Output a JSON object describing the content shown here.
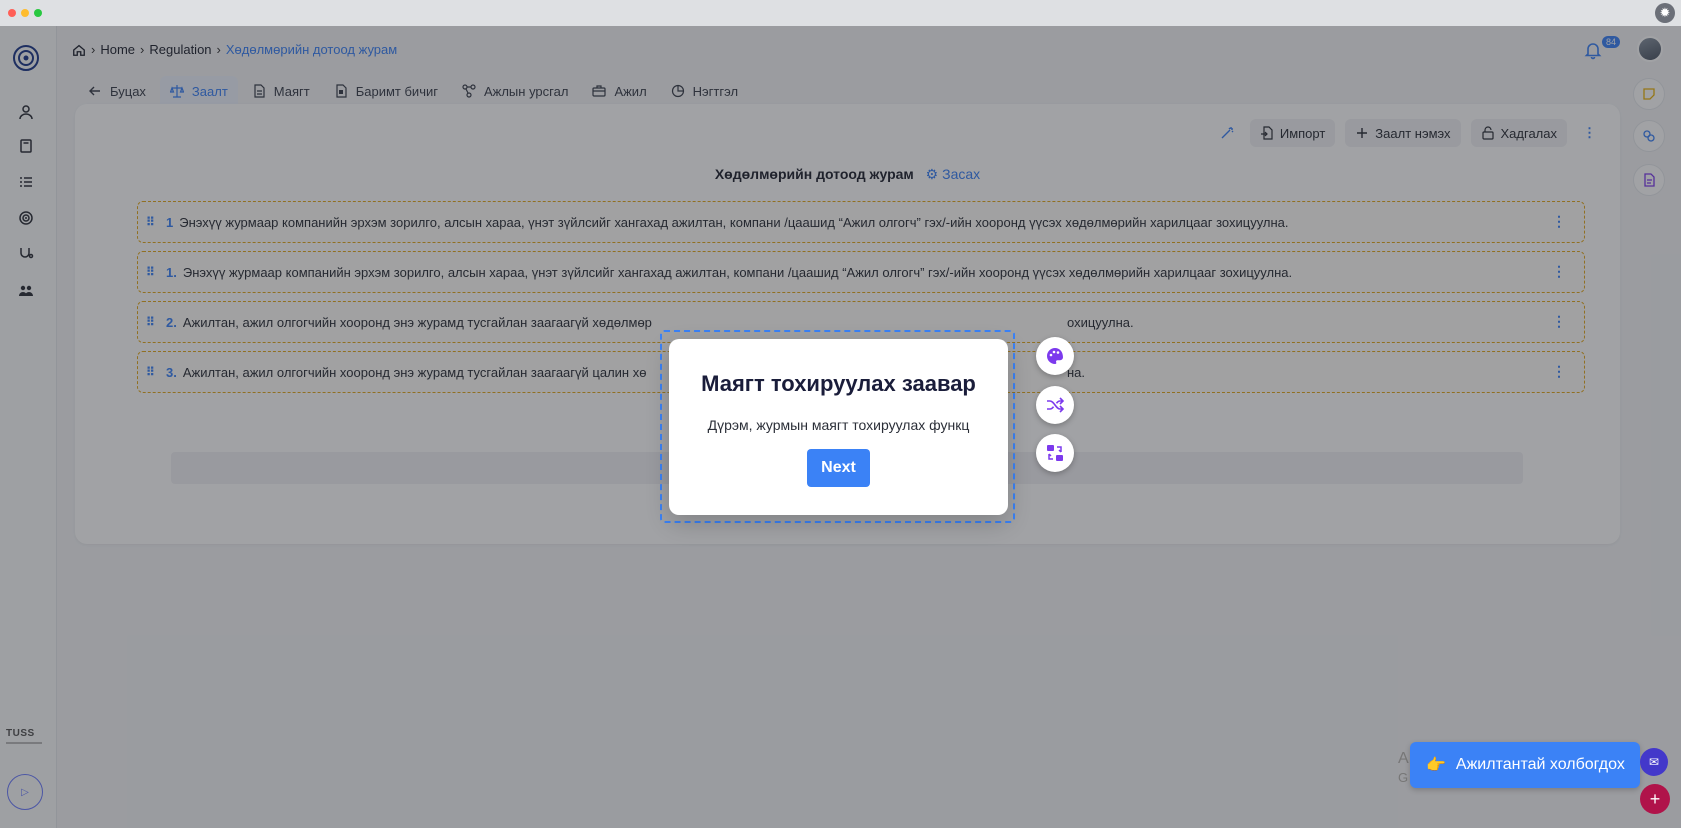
{
  "window": {
    "dots": [
      "#ff5f57",
      "#febc2e",
      "#28c840"
    ]
  },
  "breadcrumb": {
    "home": "Home",
    "regulation": "Regulation",
    "current": "Хөдөлмөрийн дотоод журам"
  },
  "notifications": {
    "count": "84"
  },
  "tabs": [
    {
      "label": "Буцах",
      "icon": "arrow-left-icon"
    },
    {
      "label": "Заалт",
      "icon": "scale-icon",
      "active": true
    },
    {
      "label": "Маягт",
      "icon": "document-icon"
    },
    {
      "label": "Баримт бичиг",
      "icon": "file-icon"
    },
    {
      "label": "Ажлын урсгал",
      "icon": "workflow-icon"
    },
    {
      "label": "Ажил",
      "icon": "briefcase-icon"
    },
    {
      "label": "Нэгтгэл",
      "icon": "chart-pie-icon"
    }
  ],
  "toolbar": {
    "import": "Импорт",
    "add_clause": "Заалт нэмэх",
    "lock": "Хадгалах"
  },
  "document": {
    "title": "Хөдөлмөрийн дотоод журам",
    "edit": "Засах"
  },
  "rules": [
    {
      "num": "1",
      "text": "Энэхүү журмаар компанийн эрхэм зорилго, алсын хараа, үнэт зүйлсийг хангахад ажилтан, компани /цаашид “Ажил олгогч” гэх/-ийн хооронд үүсэх хөдөлмөрийн харилцааг зохицуулна."
    },
    {
      "num": "1.",
      "text": "Энэхүү журмаар компанийн эрхэм зорилго, алсын хараа, үнэт зүйлсийг хангахад ажилтан, компани /цаашид “Ажил олгогч” гэх/-ийн хооронд үүсэх хөдөлмөрийн харилцааг зохицуулна."
    },
    {
      "num": "2.",
      "text": "Ажилтан, ажил олгогчийн хооронд энэ журамд тусгайлан заагаагүй хөдөлмөр"
    },
    {
      "num": "3.",
      "text": "Ажилтан, ажил олгогчийн хооронд энэ журамд тусгайлан заагаагүй цалин хө"
    }
  ],
  "rules_tail": [
    "",
    "",
    "охицуулна.",
    "на."
  ],
  "modal": {
    "title": "Маягт тохируулах заавар",
    "text": "Дүрэм, журмын маягт тохируулах функц",
    "next": "Next"
  },
  "contact": {
    "label": "Ажилтантай холбогдох",
    "emoji": "👉"
  },
  "brand": {
    "tuss": "TUSS"
  },
  "faint": {
    "a": "A",
    "g": "G"
  },
  "colors": {
    "accent": "#3b82f6",
    "rule_border": "#e3a91e",
    "fab_icon": "#7c3aed"
  }
}
